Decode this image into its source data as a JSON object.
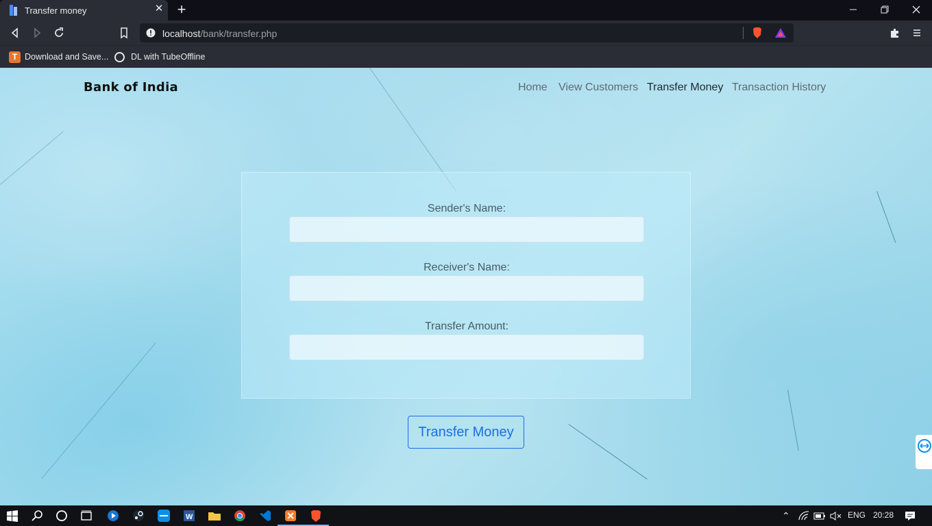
{
  "browser": {
    "tab_title": "Transfer money",
    "url_host": "localhost",
    "url_path": "/bank/transfer.php",
    "bookmarks": [
      "Download and Save...",
      "DL with TubeOffline"
    ]
  },
  "site": {
    "brand": "Bank of India",
    "nav": [
      {
        "label": "Home",
        "active": false
      },
      {
        "label": "View Customers",
        "active": false
      },
      {
        "label": "Transfer Money",
        "active": true
      },
      {
        "label": "Transaction History",
        "active": false
      }
    ]
  },
  "form": {
    "sender_label": "Sender's Name:",
    "sender_value": "",
    "receiver_label": "Receiver's Name:",
    "receiver_value": "",
    "amount_label": "Transfer Amount:",
    "amount_value": "",
    "submit_label": "Transfer Money"
  },
  "taskbar": {
    "language": "ENG",
    "time": "20:28"
  },
  "colors": {
    "accent": "#1a6fe0",
    "brand_text": "#111111",
    "chrome_bg": "#2b2d36"
  }
}
